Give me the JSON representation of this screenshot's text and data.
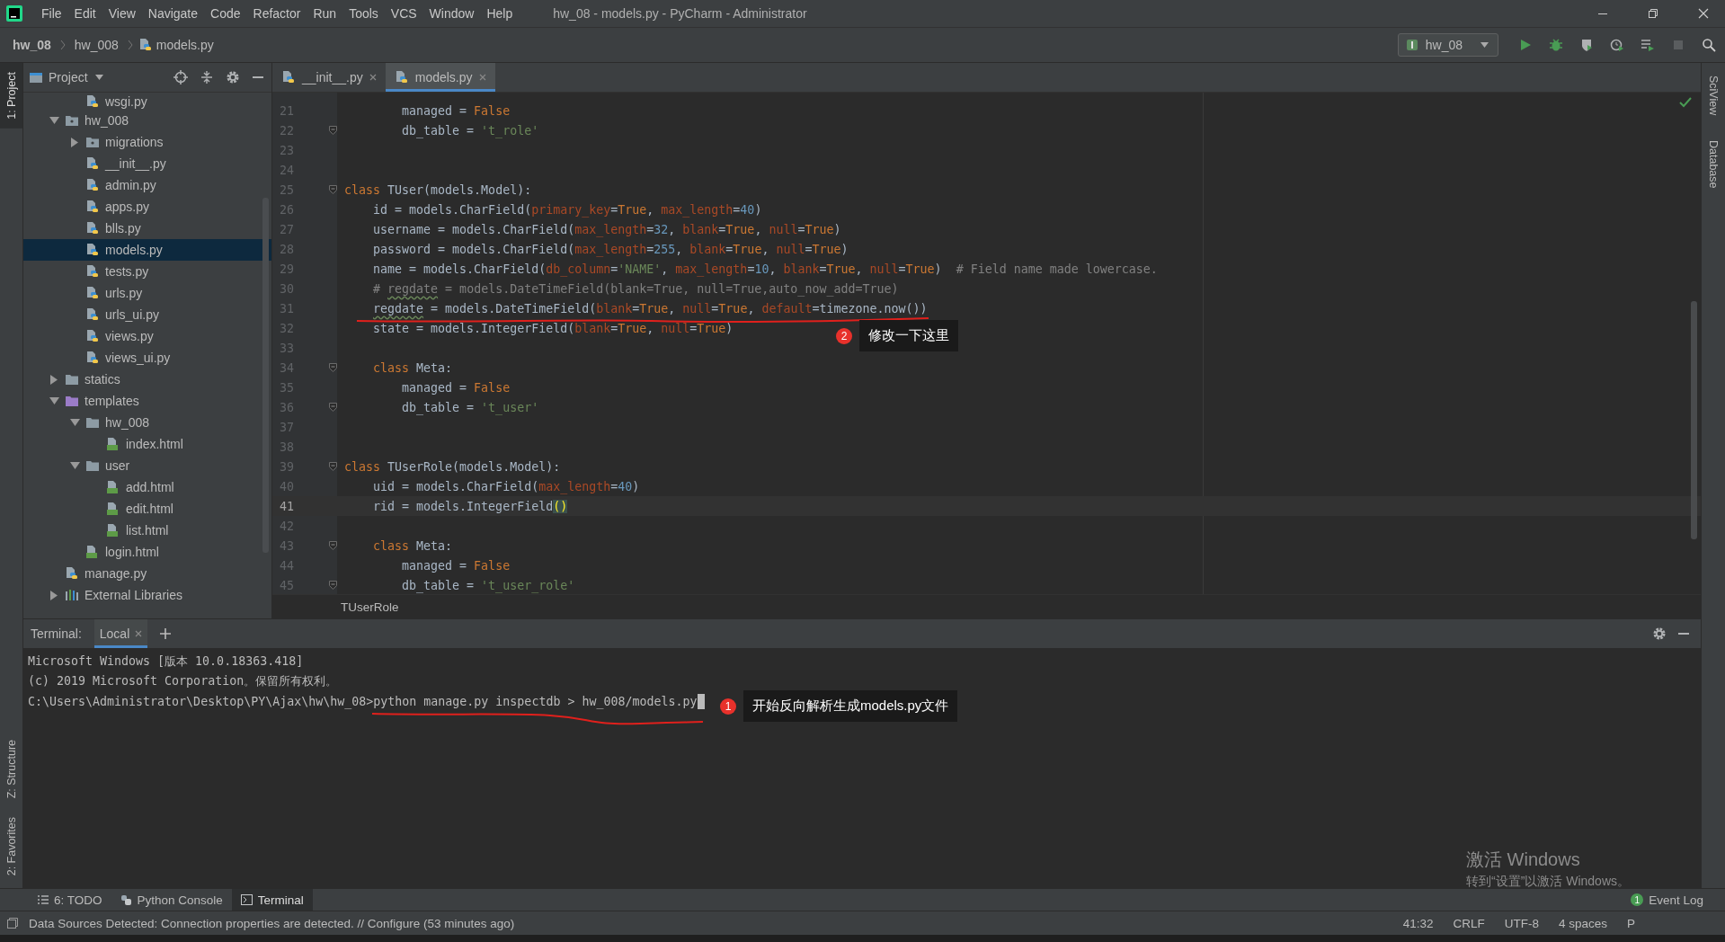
{
  "window": {
    "title": "hw_08 - models.py - PyCharm - Administrator"
  },
  "menu": [
    "File",
    "Edit",
    "View",
    "Navigate",
    "Code",
    "Refactor",
    "Run",
    "Tools",
    "VCS",
    "Window",
    "Help"
  ],
  "breadcrumb": [
    {
      "label": "hw_08",
      "kind": "project"
    },
    {
      "label": "hw_008",
      "kind": "folder"
    },
    {
      "label": "models.py",
      "kind": "py"
    }
  ],
  "run_config": "hw_08",
  "left_strip": [
    {
      "label": "1: Project",
      "selected": true,
      "kind": "top"
    },
    {
      "label": "Z: Structure",
      "selected": false,
      "kind": "bottom"
    },
    {
      "label": "2: Favorites",
      "selected": false,
      "kind": "bottom"
    }
  ],
  "right_strip": [
    {
      "label": "SciView"
    },
    {
      "label": "Database"
    }
  ],
  "project_panel": {
    "title": "Project",
    "tree": {
      "scrolled_item": {
        "name": "wsgi.py",
        "kind": "py"
      },
      "items": [
        {
          "name": "hw_008",
          "kind": "package",
          "expanded": true,
          "selected": false,
          "children": [
            {
              "name": "migrations",
              "kind": "package",
              "expanded": false,
              "selected": false
            },
            {
              "name": "__init__.py",
              "kind": "py",
              "selected": false
            },
            {
              "name": "admin.py",
              "kind": "py",
              "selected": false
            },
            {
              "name": "apps.py",
              "kind": "py",
              "selected": false
            },
            {
              "name": "blls.py",
              "kind": "py",
              "selected": false
            },
            {
              "name": "models.py",
              "kind": "py",
              "selected": true
            },
            {
              "name": "tests.py",
              "kind": "py",
              "selected": false
            },
            {
              "name": "urls.py",
              "kind": "py",
              "selected": false
            },
            {
              "name": "urls_ui.py",
              "kind": "py",
              "selected": false
            },
            {
              "name": "views.py",
              "kind": "py",
              "selected": false
            },
            {
              "name": "views_ui.py",
              "kind": "py",
              "selected": false
            }
          ]
        },
        {
          "name": "statics",
          "kind": "folder",
          "expanded": false,
          "selected": false
        },
        {
          "name": "templates",
          "kind": "template_folder",
          "expanded": true,
          "selected": false,
          "children": [
            {
              "name": "hw_008",
              "kind": "folder",
              "expanded": true,
              "selected": false,
              "children": [
                {
                  "name": "index.html",
                  "kind": "html",
                  "selected": false
                }
              ]
            },
            {
              "name": "user",
              "kind": "folder",
              "expanded": true,
              "selected": false,
              "children": [
                {
                  "name": "add.html",
                  "kind": "html",
                  "selected": false
                },
                {
                  "name": "edit.html",
                  "kind": "html",
                  "selected": false
                },
                {
                  "name": "list.html",
                  "kind": "html",
                  "selected": false
                }
              ]
            },
            {
              "name": "login.html",
              "kind": "html",
              "selected": false
            }
          ]
        },
        {
          "name": "manage.py",
          "kind": "py",
          "selected": false
        },
        {
          "name": "External Libraries",
          "kind": "lib",
          "expanded": false,
          "selected": false
        }
      ]
    }
  },
  "editor_tabs": [
    {
      "label": "__init__.py",
      "selected": false
    },
    {
      "label": "models.py",
      "selected": true
    }
  ],
  "editor": {
    "lines": [
      {
        "number": "21",
        "fold": false,
        "current": false,
        "tokens": [
          {
            "kind": "plain",
            "text": "        managed = "
          },
          {
            "kind": "keyword",
            "text": "False"
          }
        ]
      },
      {
        "number": "22",
        "fold": true,
        "current": false,
        "tokens": [
          {
            "kind": "plain",
            "text": "        db_table = "
          },
          {
            "kind": "string",
            "text": "'t_role'"
          }
        ]
      },
      {
        "number": "23",
        "fold": false,
        "current": false
      },
      {
        "number": "24",
        "fold": false,
        "current": false
      },
      {
        "number": "25",
        "fold": true,
        "current": false,
        "tokens": [
          {
            "kind": "keyword",
            "text": "class "
          },
          {
            "kind": "plain",
            "text": "TUser(models.Model):"
          }
        ]
      },
      {
        "number": "26",
        "fold": false,
        "current": false,
        "tokens": [
          {
            "kind": "plain",
            "text": "    id = models.CharField("
          },
          {
            "kind": "param",
            "text": "primary_key"
          },
          {
            "kind": "plain",
            "text": "="
          },
          {
            "kind": "keyword",
            "text": "True"
          },
          {
            "kind": "plain",
            "text": ", "
          },
          {
            "kind": "param",
            "text": "max_length"
          },
          {
            "kind": "plain",
            "text": "="
          },
          {
            "kind": "number",
            "text": "40"
          },
          {
            "kind": "plain",
            "text": ")"
          }
        ]
      },
      {
        "number": "27",
        "fold": false,
        "current": false,
        "tokens": [
          {
            "kind": "plain",
            "text": "    username = models.CharField("
          },
          {
            "kind": "param",
            "text": "max_length"
          },
          {
            "kind": "plain",
            "text": "="
          },
          {
            "kind": "number",
            "text": "32"
          },
          {
            "kind": "plain",
            "text": ", "
          },
          {
            "kind": "param",
            "text": "blank"
          },
          {
            "kind": "plain",
            "text": "="
          },
          {
            "kind": "keyword",
            "text": "True"
          },
          {
            "kind": "plain",
            "text": ", "
          },
          {
            "kind": "param",
            "text": "null"
          },
          {
            "kind": "plain",
            "text": "="
          },
          {
            "kind": "keyword",
            "text": "True"
          },
          {
            "kind": "plain",
            "text": ")"
          }
        ]
      },
      {
        "number": "28",
        "fold": false,
        "current": false,
        "tokens": [
          {
            "kind": "plain",
            "text": "    password = models.CharField("
          },
          {
            "kind": "param",
            "text": "max_length"
          },
          {
            "kind": "plain",
            "text": "="
          },
          {
            "kind": "number",
            "text": "255"
          },
          {
            "kind": "plain",
            "text": ", "
          },
          {
            "kind": "param",
            "text": "blank"
          },
          {
            "kind": "plain",
            "text": "="
          },
          {
            "kind": "keyword",
            "text": "True"
          },
          {
            "kind": "plain",
            "text": ", "
          },
          {
            "kind": "param",
            "text": "null"
          },
          {
            "kind": "plain",
            "text": "="
          },
          {
            "kind": "keyword",
            "text": "True"
          },
          {
            "kind": "plain",
            "text": ")"
          }
        ]
      },
      {
        "number": "29",
        "fold": false,
        "current": false,
        "tokens": [
          {
            "kind": "plain",
            "text": "    name = models.CharField("
          },
          {
            "kind": "param",
            "text": "db_column"
          },
          {
            "kind": "plain",
            "text": "="
          },
          {
            "kind": "string",
            "text": "'NAME'"
          },
          {
            "kind": "plain",
            "text": ", "
          },
          {
            "kind": "param",
            "text": "max_length"
          },
          {
            "kind": "plain",
            "text": "="
          },
          {
            "kind": "number",
            "text": "10"
          },
          {
            "kind": "plain",
            "text": ", "
          },
          {
            "kind": "param",
            "text": "blank"
          },
          {
            "kind": "plain",
            "text": "="
          },
          {
            "kind": "keyword",
            "text": "True"
          },
          {
            "kind": "plain",
            "text": ", "
          },
          {
            "kind": "param",
            "text": "null"
          },
          {
            "kind": "plain",
            "text": "="
          },
          {
            "kind": "keyword",
            "text": "True"
          },
          {
            "kind": "plain",
            "text": ")  "
          },
          {
            "kind": "comment",
            "text": "# Field name made lowercase."
          }
        ]
      },
      {
        "number": "30",
        "fold": false,
        "current": false,
        "tokens": [
          {
            "kind": "comment",
            "text": "    # "
          },
          {
            "kind": "comment_typo",
            "text": "regdate"
          },
          {
            "kind": "comment",
            "text": " = models.DateTimeField(blank=True, null=True,auto_now_add=True)"
          }
        ]
      },
      {
        "number": "31",
        "fold": false,
        "current": false,
        "tokens": [
          {
            "kind": "typo",
            "text": "    regdate"
          },
          {
            "kind": "plain",
            "text": " = models.DateTimeField("
          },
          {
            "kind": "param",
            "text": "blank"
          },
          {
            "kind": "plain",
            "text": "="
          },
          {
            "kind": "keyword",
            "text": "True"
          },
          {
            "kind": "plain",
            "text": ", "
          },
          {
            "kind": "param",
            "text": "null"
          },
          {
            "kind": "plain",
            "text": "="
          },
          {
            "kind": "keyword",
            "text": "True"
          },
          {
            "kind": "plain",
            "text": ", "
          },
          {
            "kind": "param",
            "text": "default"
          },
          {
            "kind": "plain",
            "text": "=timezone.now())"
          }
        ]
      },
      {
        "number": "32",
        "fold": false,
        "current": false,
        "tokens": [
          {
            "kind": "plain",
            "text": "    state = models.IntegerField("
          },
          {
            "kind": "param",
            "text": "blank"
          },
          {
            "kind": "plain",
            "text": "="
          },
          {
            "kind": "keyword",
            "text": "True"
          },
          {
            "kind": "plain",
            "text": ", "
          },
          {
            "kind": "param",
            "text": "null"
          },
          {
            "kind": "plain",
            "text": "="
          },
          {
            "kind": "keyword",
            "text": "True"
          },
          {
            "kind": "plain",
            "text": ")"
          }
        ]
      },
      {
        "number": "33",
        "fold": false,
        "current": false
      },
      {
        "number": "34",
        "fold": true,
        "current": false,
        "tokens": [
          {
            "kind": "keyword",
            "text": "    class "
          },
          {
            "kind": "plain",
            "text": "Meta:"
          }
        ]
      },
      {
        "number": "35",
        "fold": false,
        "current": false,
        "tokens": [
          {
            "kind": "plain",
            "text": "        managed = "
          },
          {
            "kind": "keyword",
            "text": "False"
          }
        ]
      },
      {
        "number": "36",
        "fold": true,
        "current": false,
        "tokens": [
          {
            "kind": "plain",
            "text": "        db_table = "
          },
          {
            "kind": "string",
            "text": "'t_user'"
          }
        ]
      },
      {
        "number": "37",
        "fold": false,
        "current": false
      },
      {
        "number": "38",
        "fold": false,
        "current": false
      },
      {
        "number": "39",
        "fold": true,
        "current": false,
        "tokens": [
          {
            "kind": "keyword",
            "text": "class "
          },
          {
            "kind": "plain",
            "text": "TUserRole(models.Model):"
          }
        ]
      },
      {
        "number": "40",
        "fold": false,
        "current": false,
        "tokens": [
          {
            "kind": "plain",
            "text": "    uid = models.CharField("
          },
          {
            "kind": "param",
            "text": "max_length"
          },
          {
            "kind": "plain",
            "text": "="
          },
          {
            "kind": "number",
            "text": "40"
          },
          {
            "kind": "plain",
            "text": ")"
          }
        ]
      },
      {
        "number": "41",
        "fold": false,
        "current": true,
        "tokens": [
          {
            "kind": "plain",
            "text": "    rid = models.IntegerField"
          },
          {
            "kind": "brace",
            "text": "()"
          }
        ]
      },
      {
        "number": "42",
        "fold": false,
        "current": false
      },
      {
        "number": "43",
        "fold": true,
        "current": false,
        "tokens": [
          {
            "kind": "keyword",
            "text": "    class "
          },
          {
            "kind": "plain",
            "text": "Meta:"
          }
        ]
      },
      {
        "number": "44",
        "fold": false,
        "current": false,
        "tokens": [
          {
            "kind": "plain",
            "text": "        managed = "
          },
          {
            "kind": "keyword",
            "text": "False"
          }
        ]
      },
      {
        "number": "45",
        "fold": true,
        "current": false,
        "tokens": [
          {
            "kind": "plain",
            "text": "        db_table = "
          },
          {
            "kind": "string",
            "text": "'t_user_role'"
          }
        ]
      }
    ],
    "breadcrumb": "TUserRole",
    "annotation": {
      "number": "2",
      "text": "修改一下这里"
    }
  },
  "terminal": {
    "title": "Terminal:",
    "tabs": [
      {
        "label": "Local",
        "selected": true
      }
    ],
    "lines": [
      {
        "text": "Microsoft Windows [版本 10.0.18363.418]",
        "cursor": false
      },
      {
        "text": "(c) 2019 Microsoft Corporation。保留所有权利。",
        "cursor": false
      },
      {
        "text": "C:\\Users\\Administrator\\Desktop\\PY\\Ajax\\hw\\hw_08>python manage.py inspectdb > hw_008/models.py",
        "cursor": true
      }
    ],
    "annotation": {
      "number": "1",
      "text": "开始反向解析生成models.py文件"
    }
  },
  "os_overlay": {
    "title": "激活 Windows",
    "subtitle": "转到“设置”以激活 Windows。"
  },
  "bottom_tools": [
    {
      "label": "6: TODO",
      "kind": "todo",
      "selected": false
    },
    {
      "label": "Python Console",
      "kind": "console",
      "selected": false
    },
    {
      "label": "Terminal",
      "kind": "terminal",
      "selected": true
    }
  ],
  "status_bar": {
    "message": "Data Sources Detected: Connection properties are detected. // Configure (53 minutes ago)",
    "items": [
      "41:32",
      "CRLF",
      "UTF-8",
      "4 spaces",
      "P"
    ],
    "event_log": {
      "label": "Event Log",
      "count": "1"
    }
  }
}
